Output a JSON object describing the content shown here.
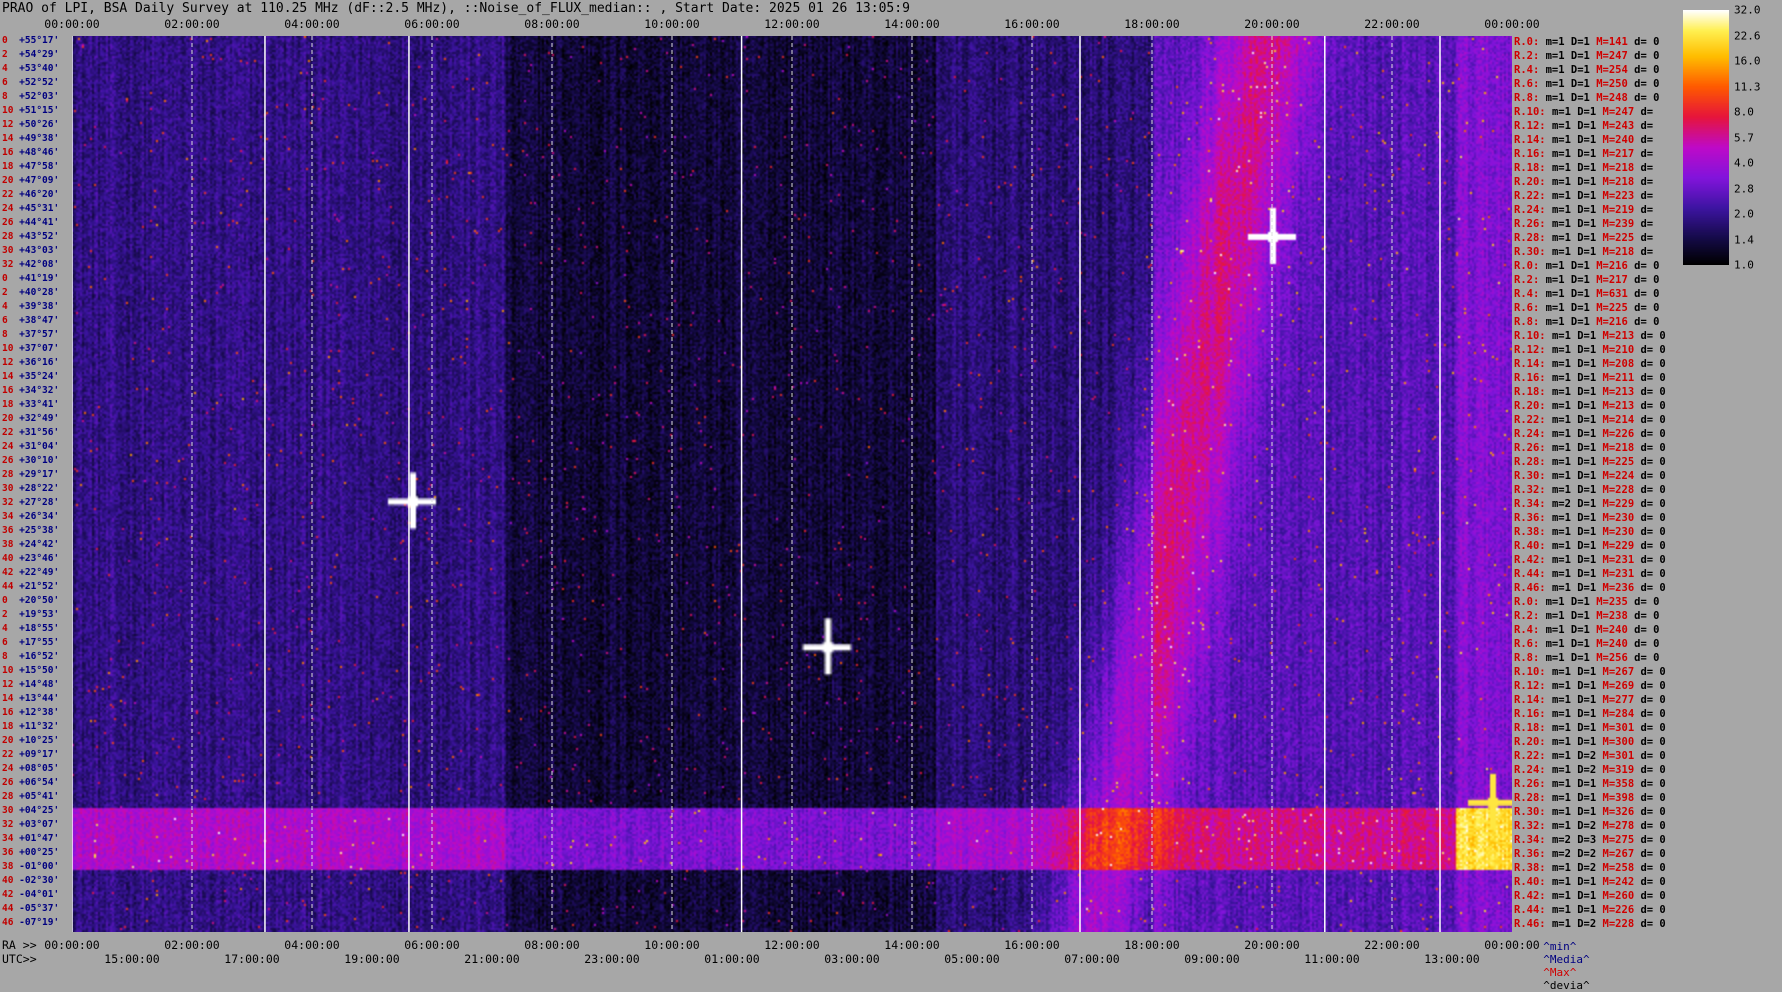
{
  "title": "PRAO of LPI, BSA Daily Survey at 110.25 MHz (dF::2.5 MHz), ::Noise_of_FLUX_median:: , Start Date: 2025 01 26 13:05:9",
  "top_ticks": [
    "00:00:00",
    "02:00:00",
    "04:00:00",
    "06:00:00",
    "08:00:00",
    "10:00:00",
    "12:00:00",
    "14:00:00",
    "16:00:00",
    "18:00:00",
    "20:00:00",
    "22:00:00",
    "00:00:00"
  ],
  "bottom_ra_label": "RA >>",
  "bottom_ra_ticks": [
    "00:00:00",
    "02:00:00",
    "04:00:00",
    "06:00:00",
    "08:00:00",
    "10:00:00",
    "12:00:00",
    "14:00:00",
    "16:00:00",
    "18:00:00",
    "20:00:00",
    "22:00:00",
    "00:00:00"
  ],
  "bottom_utc_label": "UTC>>",
  "bottom_utc_ticks": [
    "15:00:00",
    "17:00:00",
    "19:00:00",
    "21:00:00",
    "23:00:00",
    "01:00:00",
    "03:00:00",
    "05:00:00",
    "07:00:00",
    "09:00:00",
    "11:00:00",
    "13:00:00"
  ],
  "left_labels": [
    {
      "i": "0",
      "d": "+55°17'"
    },
    {
      "i": "2",
      "d": "+54°29'"
    },
    {
      "i": "4",
      "d": "+53°40'"
    },
    {
      "i": "6",
      "d": "+52°52'"
    },
    {
      "i": "8",
      "d": "+52°03'"
    },
    {
      "i": "10",
      "d": "+51°15'"
    },
    {
      "i": "12",
      "d": "+50°26'"
    },
    {
      "i": "14",
      "d": "+49°38'"
    },
    {
      "i": "16",
      "d": "+48°46'"
    },
    {
      "i": "18",
      "d": "+47°58'"
    },
    {
      "i": "20",
      "d": "+47°09'"
    },
    {
      "i": "22",
      "d": "+46°20'"
    },
    {
      "i": "24",
      "d": "+45°31'"
    },
    {
      "i": "26",
      "d": "+44°41'"
    },
    {
      "i": "28",
      "d": "+43°52'"
    },
    {
      "i": "30",
      "d": "+43°03'"
    },
    {
      "i": "32",
      "d": "+42°08'"
    },
    {
      "i": "0",
      "d": "+41°19'"
    },
    {
      "i": "2",
      "d": "+40°28'"
    },
    {
      "i": "4",
      "d": "+39°38'"
    },
    {
      "i": "6",
      "d": "+38°47'"
    },
    {
      "i": "8",
      "d": "+37°57'"
    },
    {
      "i": "10",
      "d": "+37°07'"
    },
    {
      "i": "12",
      "d": "+36°16'"
    },
    {
      "i": "14",
      "d": "+35°24'"
    },
    {
      "i": "16",
      "d": "+34°32'"
    },
    {
      "i": "18",
      "d": "+33°41'"
    },
    {
      "i": "20",
      "d": "+32°49'"
    },
    {
      "i": "22",
      "d": "+31°56'"
    },
    {
      "i": "24",
      "d": "+31°04'"
    },
    {
      "i": "26",
      "d": "+30°10'"
    },
    {
      "i": "28",
      "d": "+29°17'"
    },
    {
      "i": "30",
      "d": "+28°22'"
    },
    {
      "i": "32",
      "d": "+27°28'"
    },
    {
      "i": "34",
      "d": "+26°34'"
    },
    {
      "i": "36",
      "d": "+25°38'"
    },
    {
      "i": "38",
      "d": "+24°42'"
    },
    {
      "i": "40",
      "d": "+23°46'"
    },
    {
      "i": "42",
      "d": "+22°49'"
    },
    {
      "i": "44",
      "d": "+21°52'"
    },
    {
      "i": "0",
      "d": "+20°50'"
    },
    {
      "i": "2",
      "d": "+19°53'"
    },
    {
      "i": "4",
      "d": "+18°55'"
    },
    {
      "i": "6",
      "d": "+17°55'"
    },
    {
      "i": "8",
      "d": "+16°52'"
    },
    {
      "i": "10",
      "d": "+15°50'"
    },
    {
      "i": "12",
      "d": "+14°48'"
    },
    {
      "i": "14",
      "d": "+13°44'"
    },
    {
      "i": "16",
      "d": "+12°38'"
    },
    {
      "i": "18",
      "d": "+11°32'"
    },
    {
      "i": "20",
      "d": "+10°25'"
    },
    {
      "i": "22",
      "d": "+09°17'"
    },
    {
      "i": "24",
      "d": "+08°05'"
    },
    {
      "i": "26",
      "d": "+06°54'"
    },
    {
      "i": "28",
      "d": "+05°41'"
    },
    {
      "i": "30",
      "d": "+04°25'"
    },
    {
      "i": "32",
      "d": "+03°07'"
    },
    {
      "i": "34",
      "d": "+01°47'"
    },
    {
      "i": "36",
      "d": "+00°25'"
    },
    {
      "i": "38",
      "d": "-01°00'"
    },
    {
      "i": "40",
      "d": "-02°30'"
    },
    {
      "i": "42",
      "d": "-04°01'"
    },
    {
      "i": "44",
      "d": "-05°37'"
    },
    {
      "i": "46",
      "d": "-07°19'"
    }
  ],
  "right_labels": [
    {
      "r": "R.0:",
      "D": "D=1",
      "M": "M=141",
      "d": "d= 0"
    },
    {
      "r": "R.2:",
      "D": "D=1",
      "M": "M=247",
      "d": "d= 0"
    },
    {
      "r": "R.4:",
      "D": "D=1",
      "M": "M=254",
      "d": "d= 0"
    },
    {
      "r": "R.6:",
      "D": "D=1",
      "M": "M=250",
      "d": "d= 0"
    },
    {
      "r": "R.8:",
      "D": "D=1",
      "M": "M=248",
      "d": "d= 0"
    },
    {
      "r": "R.10:",
      "D": "D=1",
      "M": "M=247",
      "d": "d="
    },
    {
      "r": "R.12:",
      "D": "D=1",
      "M": "M=243",
      "d": "d="
    },
    {
      "r": "R.14:",
      "D": "D=1",
      "M": "M=240",
      "d": "d="
    },
    {
      "r": "R.16:",
      "D": "D=1",
      "M": "M=217",
      "d": "d="
    },
    {
      "r": "R.18:",
      "D": "D=1",
      "M": "M=218",
      "d": "d="
    },
    {
      "r": "R.20:",
      "D": "D=1",
      "M": "M=218",
      "d": "d="
    },
    {
      "r": "R.22:",
      "D": "D=1",
      "M": "M=223",
      "d": "d="
    },
    {
      "r": "R.24:",
      "D": "D=1",
      "M": "M=219",
      "d": "d="
    },
    {
      "r": "R.26:",
      "D": "D=1",
      "M": "M=239",
      "d": "d="
    },
    {
      "r": "R.28:",
      "D": "D=1",
      "M": "M=225",
      "d": "d="
    },
    {
      "r": "R.30:",
      "D": "D=1",
      "M": "M=218",
      "d": "d="
    },
    {
      "r": "R.0:",
      "D": "D=1",
      "M": "M=216",
      "d": "d= 0"
    },
    {
      "r": "R.2:",
      "D": "D=1",
      "M": "M=217",
      "d": "d= 0"
    },
    {
      "r": "R.4:",
      "D": "D=1",
      "M": "M=631",
      "d": "d= 0"
    },
    {
      "r": "R.6:",
      "D": "D=1",
      "M": "M=225",
      "d": "d= 0"
    },
    {
      "r": "R.8:",
      "D": "D=1",
      "M": "M=216",
      "d": "d= 0"
    },
    {
      "r": "R.10:",
      "D": "D=1",
      "M": "M=213",
      "d": "d= 0"
    },
    {
      "r": "R.12:",
      "D": "D=1",
      "M": "M=210",
      "d": "d= 0"
    },
    {
      "r": "R.14:",
      "D": "D=1",
      "M": "M=208",
      "d": "d= 0"
    },
    {
      "r": "R.16:",
      "D": "D=1",
      "M": "M=211",
      "d": "d= 0"
    },
    {
      "r": "R.18:",
      "D": "D=1",
      "M": "M=213",
      "d": "d= 0"
    },
    {
      "r": "R.20:",
      "D": "D=1",
      "M": "M=213",
      "d": "d= 0"
    },
    {
      "r": "R.22:",
      "D": "D=1",
      "M": "M=214",
      "d": "d= 0"
    },
    {
      "r": "R.24:",
      "D": "D=1",
      "M": "M=226",
      "d": "d= 0"
    },
    {
      "r": "R.26:",
      "D": "D=1",
      "M": "M=218",
      "d": "d= 0"
    },
    {
      "r": "R.28:",
      "D": "D=1",
      "M": "M=225",
      "d": "d= 0"
    },
    {
      "r": "R.30:",
      "D": "D=1",
      "M": "M=224",
      "d": "d= 0"
    },
    {
      "r": "R.32:",
      "D": "D=1",
      "M": "M=228",
      "d": "d= 0"
    },
    {
      "r": "R.34:",
      "D": "D=1",
      "M": "M=229",
      "d": "d= 0"
    },
    {
      "r": "R.36:",
      "D": "D=1",
      "M": "M=230",
      "d": "d= 0"
    },
    {
      "r": "R.38:",
      "D": "D=1",
      "M": "M=230",
      "d": "d= 0"
    },
    {
      "r": "R.40:",
      "D": "D=1",
      "M": "M=229",
      "d": "d= 0"
    },
    {
      "r": "R.42:",
      "D": "D=1",
      "M": "M=231",
      "d": "d= 0"
    },
    {
      "r": "R.44:",
      "D": "D=1",
      "M": "M=231",
      "d": "d= 0"
    },
    {
      "r": "R.46:",
      "D": "D=1",
      "M": "M=236",
      "d": "d= 0"
    },
    {
      "r": "R.0:",
      "D": "D=1",
      "M": "M=235",
      "d": "d= 0"
    },
    {
      "r": "R.2:",
      "D": "D=1",
      "M": "M=238",
      "d": "d= 0"
    },
    {
      "r": "R.4:",
      "D": "D=1",
      "M": "M=240",
      "d": "d= 0"
    },
    {
      "r": "R.6:",
      "D": "D=1",
      "M": "M=240",
      "d": "d= 0"
    },
    {
      "r": "R.8:",
      "D": "D=1",
      "M": "M=256",
      "d": "d= 0"
    },
    {
      "r": "R.10:",
      "D": "D=1",
      "M": "M=267",
      "d": "d= 0"
    },
    {
      "r": "R.12:",
      "D": "D=1",
      "M": "M=269",
      "d": "d= 0"
    },
    {
      "r": "R.14:",
      "D": "D=1",
      "M": "M=277",
      "d": "d= 0"
    },
    {
      "r": "R.16:",
      "D": "D=1",
      "M": "M=284",
      "d": "d= 0"
    },
    {
      "r": "R.18:",
      "D": "D=1",
      "M": "M=301",
      "d": "d= 0"
    },
    {
      "r": "R.20:",
      "D": "D=1",
      "M": "M=300",
      "d": "d= 0"
    },
    {
      "r": "R.22:",
      "D": "D=2",
      "M": "M=301",
      "d": "d= 0"
    },
    {
      "r": "R.24:",
      "D": "D=2",
      "M": "M=319",
      "d": "d= 0"
    },
    {
      "r": "R.26:",
      "D": "D=1",
      "M": "M=358",
      "d": "d= 0"
    },
    {
      "r": "R.28:",
      "D": "D=1",
      "M": "M=398",
      "d": "d= 0"
    },
    {
      "r": "R.30:",
      "D": "D=1",
      "M": "M=326",
      "d": "d= 0"
    },
    {
      "r": "R.32:",
      "D": "D=2",
      "M": "M=278",
      "d": "d= 0"
    },
    {
      "r": "R.34:",
      "D": "D=3",
      "M": "M=275",
      "d": "d= 0"
    },
    {
      "r": "R.36:",
      "D": "D=2",
      "M": "M=267",
      "d": "d= 0"
    },
    {
      "r": "R.38:",
      "D": "D=2",
      "M": "M=258",
      "d": "d= 0"
    },
    {
      "r": "R.40:",
      "D": "D=1",
      "M": "M=242",
      "d": "d= 0"
    },
    {
      "r": "R.42:",
      "D": "D=1",
      "M": "M=260",
      "d": "d= 0"
    },
    {
      "r": "R.44:",
      "D": "D=1",
      "M": "M=226",
      "d": "d= 0"
    },
    {
      "r": "R.46:",
      "D": "D=2",
      "M": "M=228",
      "d": "d= 0"
    }
  ],
  "right_m_prefix": "m=1",
  "right_m_prefix_alt": "m=2",
  "legend": {
    "min": "^min^",
    "media": "^Media^",
    "max": "^Max^",
    "devia": "^devia^"
  },
  "colorbar": {
    "labels": [
      "32.0",
      "22.6",
      "16.0",
      "11.3",
      "8.0",
      "5.7",
      "4.0",
      "2.8",
      "2.0",
      "1.4",
      "1.0"
    ]
  },
  "chart_data": {
    "type": "heatmap",
    "title": "PRAO of LPI, BSA Daily Survey at 110.25 MHz (dF::2.5 MHz), ::Noise_of_FLUX_median:: , Start Date: 2025 01 26 13:05:9",
    "x_axis": {
      "label": "RA",
      "range": [
        "00:00:00",
        "24:00:00"
      ],
      "ticks": [
        "00:00:00",
        "02:00:00",
        "04:00:00",
        "06:00:00",
        "08:00:00",
        "10:00:00",
        "12:00:00",
        "14:00:00",
        "16:00:00",
        "18:00:00",
        "20:00:00",
        "22:00:00",
        "00:00:00"
      ]
    },
    "x2_axis": {
      "label": "UTC",
      "ticks": [
        "15:00:00",
        "17:00:00",
        "19:00:00",
        "21:00:00",
        "23:00:00",
        "01:00:00",
        "03:00:00",
        "05:00:00",
        "07:00:00",
        "09:00:00",
        "11:00:00",
        "13:00:00"
      ]
    },
    "y_axis": {
      "range": [
        "+55°17'",
        "-07°19'"
      ],
      "rows": 64
    },
    "color_scale": {
      "min": 1.0,
      "max": 32.0,
      "scale": "log2",
      "ticks": [
        32.0,
        22.6,
        16.0,
        11.3,
        8.0,
        5.7,
        4.0,
        2.8,
        2.0,
        1.4,
        1.0
      ]
    },
    "bright_sources": [
      {
        "ra": "20:00:00",
        "dec": "+41°19'",
        "value": 32.0
      },
      {
        "ra": "05:40:00",
        "dec": "+22°49'",
        "value": 32.0
      },
      {
        "ra": "12:35:00",
        "dec": "+12°38'",
        "value": 32.0
      },
      {
        "ra": "23:40:00",
        "dec": "+01°47'",
        "value": 22.6
      }
    ],
    "grid": true
  }
}
